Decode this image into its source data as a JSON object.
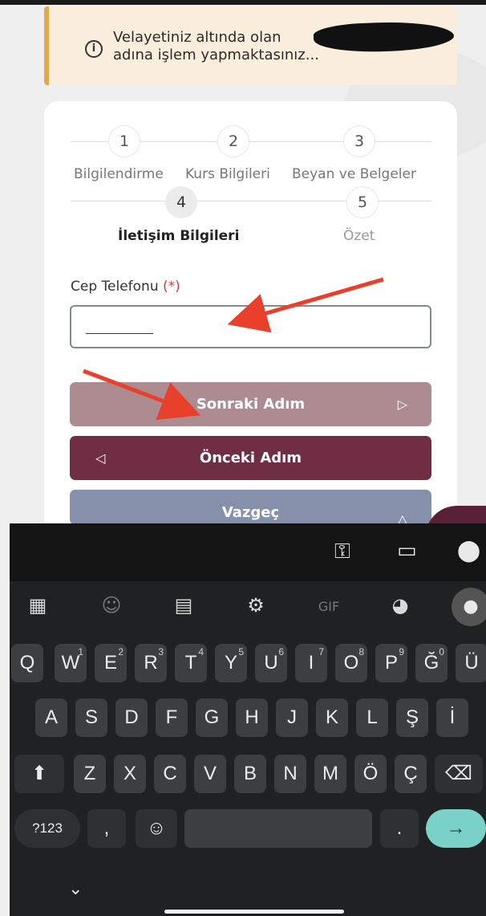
{
  "notice": {
    "text_line1": "Velayetiniz altında olan",
    "text_line2": "adına işlem yapmaktasınız...",
    "icon": "info-circle-icon"
  },
  "stepper": {
    "steps": [
      {
        "number": "1",
        "label": "Bilgilendirme",
        "state": "done"
      },
      {
        "number": "2",
        "label": "Kurs Bilgileri",
        "state": "done"
      },
      {
        "number": "3",
        "label": "Beyan ve Belgeler",
        "state": "done"
      },
      {
        "number": "4",
        "label": "İletişim Bilgileri",
        "state": "active"
      },
      {
        "number": "5",
        "label": "Özet",
        "state": "upcoming"
      }
    ]
  },
  "form": {
    "phone_label": "Cep Telefonu",
    "required_mark": "(*)",
    "phone_value": ""
  },
  "buttons": {
    "next": "Sonraki Adım",
    "prev": "Önceki Adım",
    "cancel": "Vazgeç"
  },
  "colors": {
    "next": "#ac8c90",
    "prev": "#6f2e43",
    "cancel": "#8591ab",
    "annotation_arrow": "#e8402a"
  },
  "keyboard": {
    "suggestion_icons": [
      "key-icon",
      "credit-card-icon",
      "location-pin-icon"
    ],
    "toolbar": [
      "apps-grid-icon",
      "sticker-icon",
      "clipboard-icon",
      "settings-gear-icon",
      "gif-icon",
      "palette-icon",
      "microphone-icon"
    ],
    "gif_label": "GIF",
    "row1": [
      {
        "k": "Q",
        "n": ""
      },
      {
        "k": "W",
        "n": "1"
      },
      {
        "k": "E",
        "n": "2"
      },
      {
        "k": "R",
        "n": "3"
      },
      {
        "k": "T",
        "n": "4"
      },
      {
        "k": "Y",
        "n": "5"
      },
      {
        "k": "U",
        "n": "6"
      },
      {
        "k": "I",
        "n": "7"
      },
      {
        "k": "O",
        "n": "8"
      },
      {
        "k": "P",
        "n": "9"
      },
      {
        "k": "Ğ",
        "n": "0"
      },
      {
        "k": "Ü",
        "n": ""
      }
    ],
    "row2": [
      "A",
      "S",
      "D",
      "F",
      "G",
      "H",
      "J",
      "K",
      "L",
      "Ş",
      "İ"
    ],
    "row3": [
      "Z",
      "X",
      "C",
      "V",
      "B",
      "N",
      "M",
      "Ö",
      "Ç"
    ],
    "symbols_label": "?123",
    "comma": ",",
    "period": "."
  }
}
